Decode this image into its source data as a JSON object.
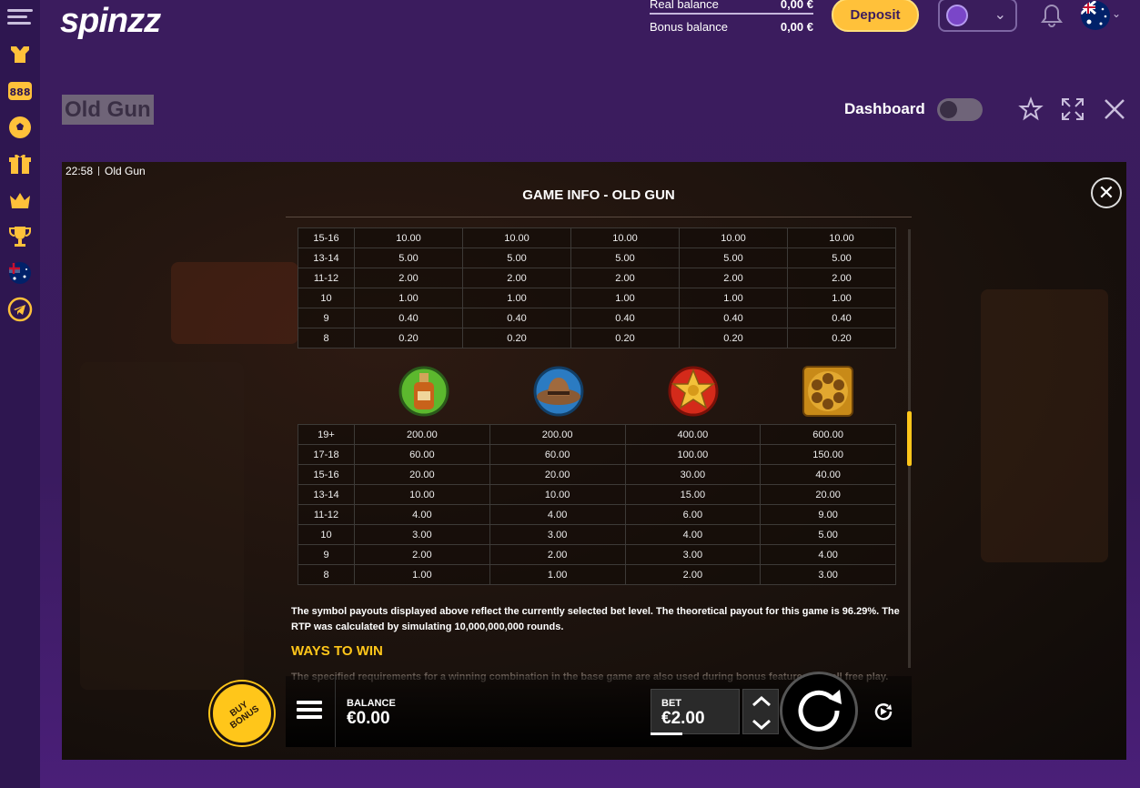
{
  "header": {
    "logo_text": "spinzz",
    "real_balance_label": "Real balance",
    "real_balance_value": "0,00 €",
    "bonus_balance_label": "Bonus balance",
    "bonus_balance_value": "0,00 €",
    "deposit_label": "Deposit"
  },
  "title_row": {
    "game_title": "Old Gun",
    "dashboard_label": "Dashboard",
    "dashboard_toggle_on": false
  },
  "game": {
    "clock": "22:58",
    "status_title": "Old Gun",
    "panel_title": "GAME INFO - OLD GUN",
    "close_icon": "close-icon",
    "table1": {
      "rows": [
        {
          "label": "15-16",
          "values": [
            "10.00",
            "10.00",
            "10.00",
            "10.00",
            "10.00"
          ]
        },
        {
          "label": "13-14",
          "values": [
            "5.00",
            "5.00",
            "5.00",
            "5.00",
            "5.00"
          ]
        },
        {
          "label": "11-12",
          "values": [
            "2.00",
            "2.00",
            "2.00",
            "2.00",
            "2.00"
          ]
        },
        {
          "label": "10",
          "values": [
            "1.00",
            "1.00",
            "1.00",
            "1.00",
            "1.00"
          ]
        },
        {
          "label": "9",
          "values": [
            "0.40",
            "0.40",
            "0.40",
            "0.40",
            "0.40"
          ]
        },
        {
          "label": "8",
          "values": [
            "0.20",
            "0.20",
            "0.20",
            "0.20",
            "0.20"
          ]
        }
      ]
    },
    "symbols": [
      "whiskey-bottle-icon",
      "cowboy-hat-icon",
      "sheriff-star-icon",
      "revolver-cylinder-icon"
    ],
    "table2": {
      "rows": [
        {
          "label": "19+",
          "values": [
            "200.00",
            "200.00",
            "400.00",
            "600.00"
          ]
        },
        {
          "label": "17-18",
          "values": [
            "60.00",
            "60.00",
            "100.00",
            "150.00"
          ]
        },
        {
          "label": "15-16",
          "values": [
            "20.00",
            "20.00",
            "30.00",
            "40.00"
          ]
        },
        {
          "label": "13-14",
          "values": [
            "10.00",
            "10.00",
            "15.00",
            "20.00"
          ]
        },
        {
          "label": "11-12",
          "values": [
            "4.00",
            "4.00",
            "6.00",
            "9.00"
          ]
        },
        {
          "label": "10",
          "values": [
            "3.00",
            "3.00",
            "4.00",
            "5.00"
          ]
        },
        {
          "label": "9",
          "values": [
            "2.00",
            "2.00",
            "3.00",
            "4.00"
          ]
        },
        {
          "label": "8",
          "values": [
            "1.00",
            "1.00",
            "2.00",
            "3.00"
          ]
        }
      ]
    },
    "payout_note": "The symbol payouts displayed above reflect the currently selected bet level. The theoretical payout for this game is 96.29%. The RTP was calculated by simulating 10,000,000,000 rounds.",
    "ways_heading": "WAYS TO WIN",
    "faded_text": "The specified requirements for a winning combination in the base game are also used during bonus features and all free play.",
    "buy_bonus_label": "BUY BONUS",
    "balance_label": "BALANCE",
    "balance_value": "€0.00",
    "bet_label": "BET",
    "bet_value": "€2.00"
  },
  "colors": {
    "accent_yellow": "#ffc61a",
    "deposit_yellow": "#ffc13a",
    "page_purple": "#3b1c5e"
  }
}
